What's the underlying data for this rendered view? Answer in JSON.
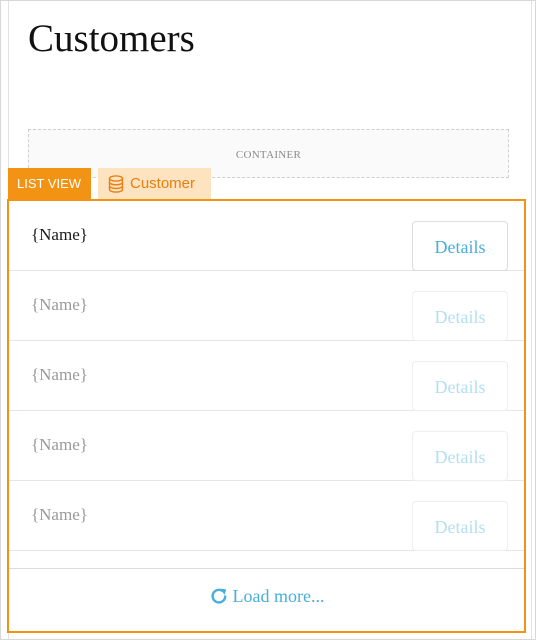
{
  "page": {
    "title": "Customers"
  },
  "container": {
    "label": "CONTAINER"
  },
  "list_view": {
    "tag_label": "LIST VIEW",
    "datasource_label": "Customer",
    "datasource_icon": "database-icon",
    "accent_color": "#f39314",
    "rows": [
      {
        "name": "{Name}",
        "button": "Details"
      },
      {
        "name": "{Name}",
        "button": "Details"
      },
      {
        "name": "{Name}",
        "button": "Details"
      },
      {
        "name": "{Name}",
        "button": "Details"
      },
      {
        "name": "{Name}",
        "button": "Details"
      }
    ],
    "load_more_label": "Load more...",
    "load_more_icon": "refresh-icon",
    "link_color": "#49aedc"
  }
}
